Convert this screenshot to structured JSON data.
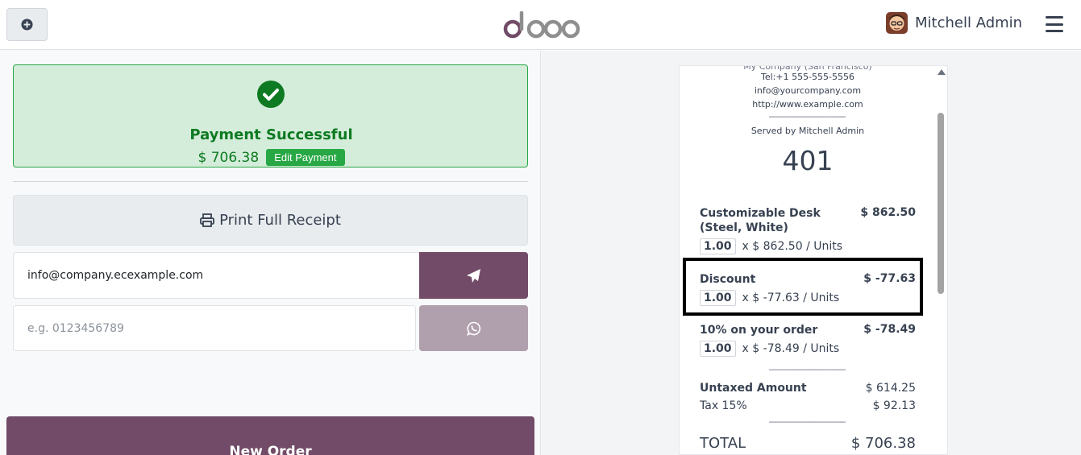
{
  "header": {
    "add_icon": "plus-circle-icon",
    "logo_text": "odoo",
    "user_name": "Mitchell Admin",
    "menu_icon": "hamburger-icon"
  },
  "payment": {
    "status_title": "Payment Successful",
    "amount": "$ 706.38",
    "edit_label": "Edit Payment",
    "status_color": "#0e7a22"
  },
  "actions": {
    "print_label": "Print Full Receipt",
    "email_value": "info@company.ecexample.com",
    "phone_placeholder": "e.g. 0123456789",
    "new_order_label": "New Order",
    "brand_color": "#714b67"
  },
  "receipt": {
    "clipped_line": "My Company (San Francisco)",
    "tel": "Tel:+1 555-555-5556",
    "email": "info@yourcompany.com",
    "website": "http://www.example.com",
    "separator": "--------------------------------",
    "served_by": "Served by Mitchell Admin",
    "order_number": "401",
    "lines": [
      {
        "name": "Customizable Desk (Steel, White)",
        "price": "$ 862.50",
        "qty": "1.00",
        "unit_price": "x $ 862.50 / Units"
      },
      {
        "name": "Discount",
        "price": "$ -77.63",
        "qty": "1.00",
        "unit_price": "x $ -77.63 / Units"
      },
      {
        "name": "10% on your order",
        "price": "$ -78.49",
        "qty": "1.00",
        "unit_price": "x $ -78.49 / Units"
      }
    ],
    "totals": {
      "separator": "--------------------------------",
      "untaxed_label": "Untaxed Amount",
      "untaxed_value": "$ 614.25",
      "tax_label": "Tax 15%",
      "tax_value": "$ 92.13",
      "total_label": "TOTAL",
      "total_value": "$ 706.38"
    }
  }
}
